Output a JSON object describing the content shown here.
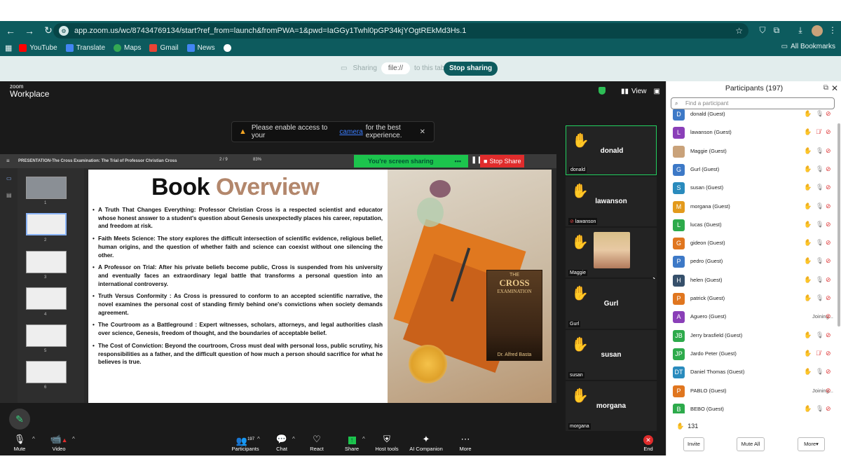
{
  "browser": {
    "url": "app.zoom.us/wc/87434769134/start?ref_from=launch&fromPWA=1&pwd=IaGGy1Twhl0pGP34kjYOgtREkMd3Hs.1",
    "bookmarks": [
      {
        "label": "YouTube",
        "icon": "youtube-icon",
        "color": "#ff0000"
      },
      {
        "label": "Translate",
        "icon": "translate-icon",
        "color": "#4285f4"
      },
      {
        "label": "Maps",
        "icon": "maps-icon",
        "color": "#34a853"
      },
      {
        "label": "Gmail",
        "icon": "gmail-icon",
        "color": "#ea4335"
      },
      {
        "label": "News",
        "icon": "news-icon",
        "color": "#4285f4"
      },
      {
        "label": "",
        "icon": "globe-icon",
        "color": "#ffffff"
      }
    ],
    "all_bookmarks": "All Bookmarks"
  },
  "sharebar": {
    "sharing": "Sharing",
    "file": "file://",
    "to_tab": "to this tab",
    "stop": "Stop sharing"
  },
  "zoom": {
    "logo_small": "zoom",
    "logo_big": "Workplace",
    "view": "View",
    "camera_warning": {
      "pre": "Please enable access to your",
      "link": "camera",
      "post": "for the best experience."
    }
  },
  "presentation": {
    "title": "PRESENTATION-The Cross Examination: The Trial of Professor Christian Cross",
    "page": "2 / 9",
    "zoom": "83%",
    "screen_sharing": "You're screen sharing",
    "stop_share": "Stop Share",
    "thumb_numbers": [
      "1",
      "2",
      "3",
      "4",
      "5",
      "6"
    ]
  },
  "slide": {
    "title_a": "Book",
    "title_b": "Overview",
    "bullets": [
      "A Truth That Changes Everything: Professor Christian Cross is a respected scientist and educator whose honest answer to a student's question about Genesis unexpectedly places his career, reputation, and freedom at risk.",
      "Faith Meets Science: The story explores the difficult intersection of scientific evidence, religious belief, human origins, and the question of whether faith and science can coexist without one silencing the other.",
      "A Professor on Trial: After his private beliefs become public, Cross is suspended from his university and eventually faces an extraordinary legal battle that transforms a personal question into an international controversy.",
      "Truth Versus Conformity : As Cross is pressured to conform to an accepted scientific narrative, the novel examines the personal cost of standing firmly behind one's convictions when society demands agreement.",
      "The Courtroom as a Battleground : Expert witnesses, scholars, attorneys, and legal authorities clash over science, Genesis, freedom of thought, and the boundaries of acceptable belief.",
      "The Cost of Conviction: Beyond the courtroom, Cross must deal with personal loss, public scrutiny, his responsibilities as a father, and the difficult question of how much a person should sacrifice for what he believes is true."
    ],
    "book": {
      "the": "THE",
      "cross": "CROSS",
      "examination": "EXAMINATION",
      "author": "Dr. Alfred Basta"
    }
  },
  "tiles": [
    {
      "name": "donald",
      "label": "donald",
      "active": true
    },
    {
      "name": "lawanson",
      "label": "lawanson",
      "active": false
    },
    {
      "name": "",
      "label": "Maggie",
      "active": false
    },
    {
      "name": "Gurl",
      "label": "Gurl",
      "active": false
    },
    {
      "name": "susan",
      "label": "susan",
      "active": false
    },
    {
      "name": "morgana",
      "label": "morgana",
      "active": false
    }
  ],
  "meetbar": {
    "mute": "Mute",
    "video": "Video",
    "participants": "Participants",
    "participants_count": "197",
    "chat": "Chat",
    "react": "React",
    "share": "Share",
    "host_tools": "Host tools",
    "ai": "AI Companion",
    "more": "More",
    "end": "End"
  },
  "panel": {
    "title": "Participants (197)",
    "search_placeholder": "Find a participant",
    "participants": [
      {
        "initial": "D",
        "name": "donald (Guest)",
        "color": "#3d79c7",
        "state": "hand"
      },
      {
        "initial": "L",
        "name": "lawanson (Guest)",
        "color": "#8a3fb8",
        "state": "hand-muted"
      },
      {
        "initial": "",
        "name": "Maggie (Guest)",
        "color": "#c9a27a",
        "state": "hand"
      },
      {
        "initial": "G",
        "name": "Gurl (Guest)",
        "color": "#3d79c7",
        "state": "hand"
      },
      {
        "initial": "S",
        "name": "susan (Guest)",
        "color": "#2a8bbd",
        "state": "hand"
      },
      {
        "initial": "M",
        "name": "morgana (Guest)",
        "color": "#e39a1c",
        "state": "hand"
      },
      {
        "initial": "L",
        "name": "lucas (Guest)",
        "color": "#2daa4b",
        "state": "hand"
      },
      {
        "initial": "G",
        "name": "gideon (Guest)",
        "color": "#e0761f",
        "state": "hand"
      },
      {
        "initial": "P",
        "name": "pedro (Guest)",
        "color": "#3d79c7",
        "state": "hand"
      },
      {
        "initial": "H",
        "name": "helen (Guest)",
        "color": "#36506b",
        "state": "hand"
      },
      {
        "initial": "P",
        "name": "patrick (Guest)",
        "color": "#e0761f",
        "state": "hand"
      },
      {
        "initial": "A",
        "name": "Aguero (Guest)",
        "color": "#8a3fb8",
        "state": "joining"
      },
      {
        "initial": "JB",
        "name": "Jerry brasfield (Guest)",
        "color": "#2daa4b",
        "state": "hand"
      },
      {
        "initial": "JP",
        "name": "Jardo Peter (Guest)",
        "color": "#2daa4b",
        "state": "hand-muted"
      },
      {
        "initial": "DT",
        "name": "Daniel Thomas (Guest)",
        "color": "#2a8bbd",
        "state": "hand"
      },
      {
        "initial": "P",
        "name": "PABLO (Guest)",
        "color": "#e0761f",
        "state": "joining"
      },
      {
        "initial": "B",
        "name": "BEBO (Guest)",
        "color": "#2daa4b",
        "state": "hand"
      }
    ],
    "joining_text": "Joining...",
    "hand_count": "131",
    "invite": "Invite",
    "mute_all": "Mute All",
    "more": "More"
  }
}
